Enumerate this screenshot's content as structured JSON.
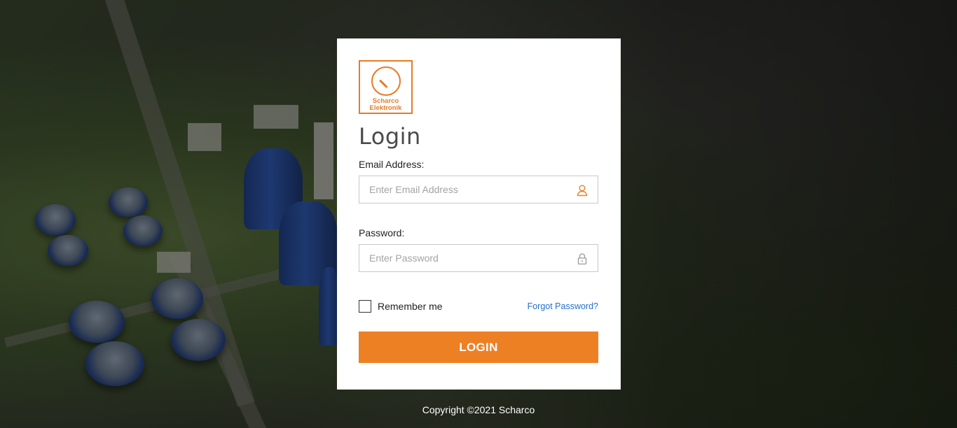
{
  "logo": {
    "line1": "Scharco",
    "line2": "Elektronik",
    "icon": "gauge-icon"
  },
  "login": {
    "title": "Login",
    "email_label": "Email Address:",
    "email_placeholder": "Enter Email Address",
    "email_value": "",
    "email_icon": "user-icon",
    "password_label": "Password:",
    "password_placeholder": "Enter Password",
    "password_value": "",
    "password_icon": "lock-icon",
    "remember_label": "Remember me",
    "remember_checked": false,
    "forgot_label": "Forgot Password?",
    "submit_label": "LOGIN"
  },
  "footer": {
    "copyright": "Copyright ©2021 Scharco"
  },
  "colors": {
    "accent": "#ee8024",
    "link": "#1f6fd1",
    "card_bg": "#ffffff"
  }
}
